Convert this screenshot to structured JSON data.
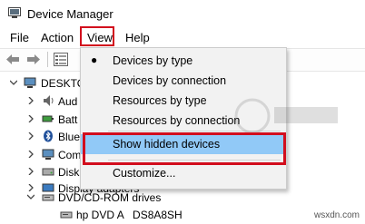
{
  "window": {
    "title": "Device Manager",
    "icon": "device-manager-icon"
  },
  "menubar": {
    "items": [
      "File",
      "Action",
      "View",
      "Help"
    ]
  },
  "toolbar": {
    "icons": [
      "back-arrow-icon",
      "forward-arrow-icon",
      "properties-icon"
    ]
  },
  "tree": {
    "root": "DESKTO",
    "items": [
      {
        "label": "Aud",
        "icon": "audio-icon"
      },
      {
        "label": "Batt",
        "icon": "battery-icon"
      },
      {
        "label": "Blue",
        "icon": "bluetooth-icon"
      },
      {
        "label": "Com",
        "icon": "computer-icon"
      },
      {
        "label": "Disk",
        "icon": "disk-drive-icon"
      },
      {
        "label": "Display adapters",
        "icon": "display-adapter-icon"
      },
      {
        "label": "DVD/CD-ROM drives",
        "icon": "dvd-drive-icon"
      },
      {
        "label": "hp DVD A   DS8A8SH",
        "icon": "dvd-drive-icon"
      }
    ]
  },
  "view_menu": {
    "items": [
      {
        "label": "Devices by type",
        "checked": true
      },
      {
        "label": "Devices by connection",
        "checked": false
      },
      {
        "label": "Resources by type",
        "checked": false
      },
      {
        "label": "Resources by connection",
        "checked": false
      },
      {
        "label": "Show hidden devices",
        "checked": false,
        "highlighted": true
      },
      {
        "label": "Customize...",
        "checked": false
      }
    ]
  },
  "watermark": "wsxdn.com",
  "colors": {
    "highlight": "#91c9f7",
    "annotation_red": "#d20d1d",
    "menu_bg": "#f2f2f2"
  }
}
